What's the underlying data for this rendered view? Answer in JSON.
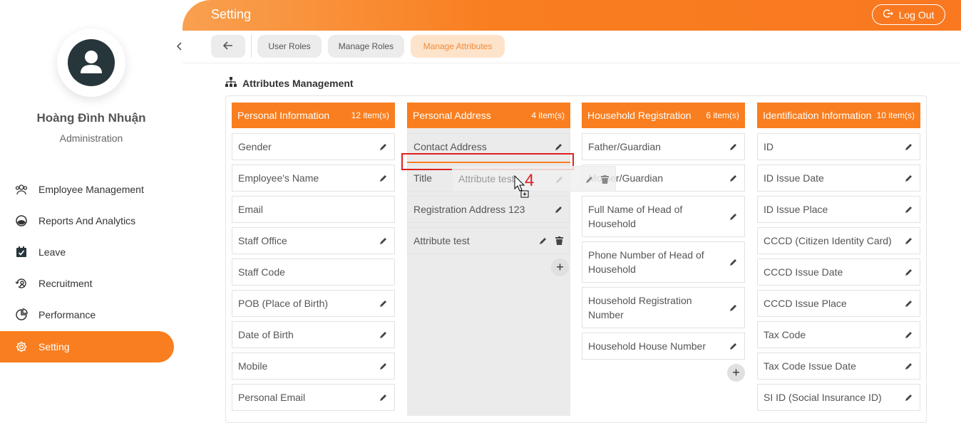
{
  "header": {
    "title": "Setting",
    "logout_label": "Log Out"
  },
  "user": {
    "name": "Hoàng Đình Nhuận",
    "role": "Administration"
  },
  "nav": [
    {
      "label": "Employee Management",
      "icon": "users-icon"
    },
    {
      "label": "Reports And Analytics",
      "icon": "chart-pie-icon"
    },
    {
      "label": "Leave",
      "icon": "calendar-check-icon"
    },
    {
      "label": "Recruitment",
      "icon": "recruit-icon"
    },
    {
      "label": "Performance",
      "icon": "performance-icon"
    },
    {
      "label": "Setting",
      "icon": "gear-icon",
      "active": true
    }
  ],
  "tabs": [
    {
      "label": "User Roles"
    },
    {
      "label": "Manage Roles"
    },
    {
      "label": "Manage Attributes",
      "active": true
    }
  ],
  "section_title": "Attributes Management",
  "columns": [
    {
      "title": "Personal Information",
      "count": "12 item(s)",
      "items": [
        "Gender",
        "Employee's Name",
        "Email",
        "Staff Office",
        "Staff Code",
        "POB (Place of Birth)",
        "Date of Birth",
        "Mobile",
        "Personal Email"
      ]
    },
    {
      "title": "Personal Address",
      "count": "4 item(s)",
      "items": [
        "Contact Address",
        "Title",
        "Registration Address 123",
        "Attribute test"
      ]
    },
    {
      "title": "Household Registration",
      "count": "6 item(s)",
      "items": [
        "Father/Guardian",
        "Mother/Guardian",
        "Full Name of Head of Household",
        "Phone Number of Head of Household",
        "Household Registration Number",
        "Household House Number"
      ]
    },
    {
      "title": "Identification Information",
      "count": "10 item(s)",
      "items": [
        "ID",
        "ID Issue Date",
        "ID Issue Place",
        "CCCD (Citizen Identity Card)",
        "CCCD Issue Date",
        "CCCD Issue Place",
        "Tax Code",
        "Tax Code Issue Date",
        "SI ID (Social Insurance ID)"
      ]
    }
  ],
  "drag": {
    "ghost_label": "Attribute test",
    "annotation": "4"
  },
  "colors": {
    "accent": "#f97e1f",
    "highlight": "#e02020"
  }
}
